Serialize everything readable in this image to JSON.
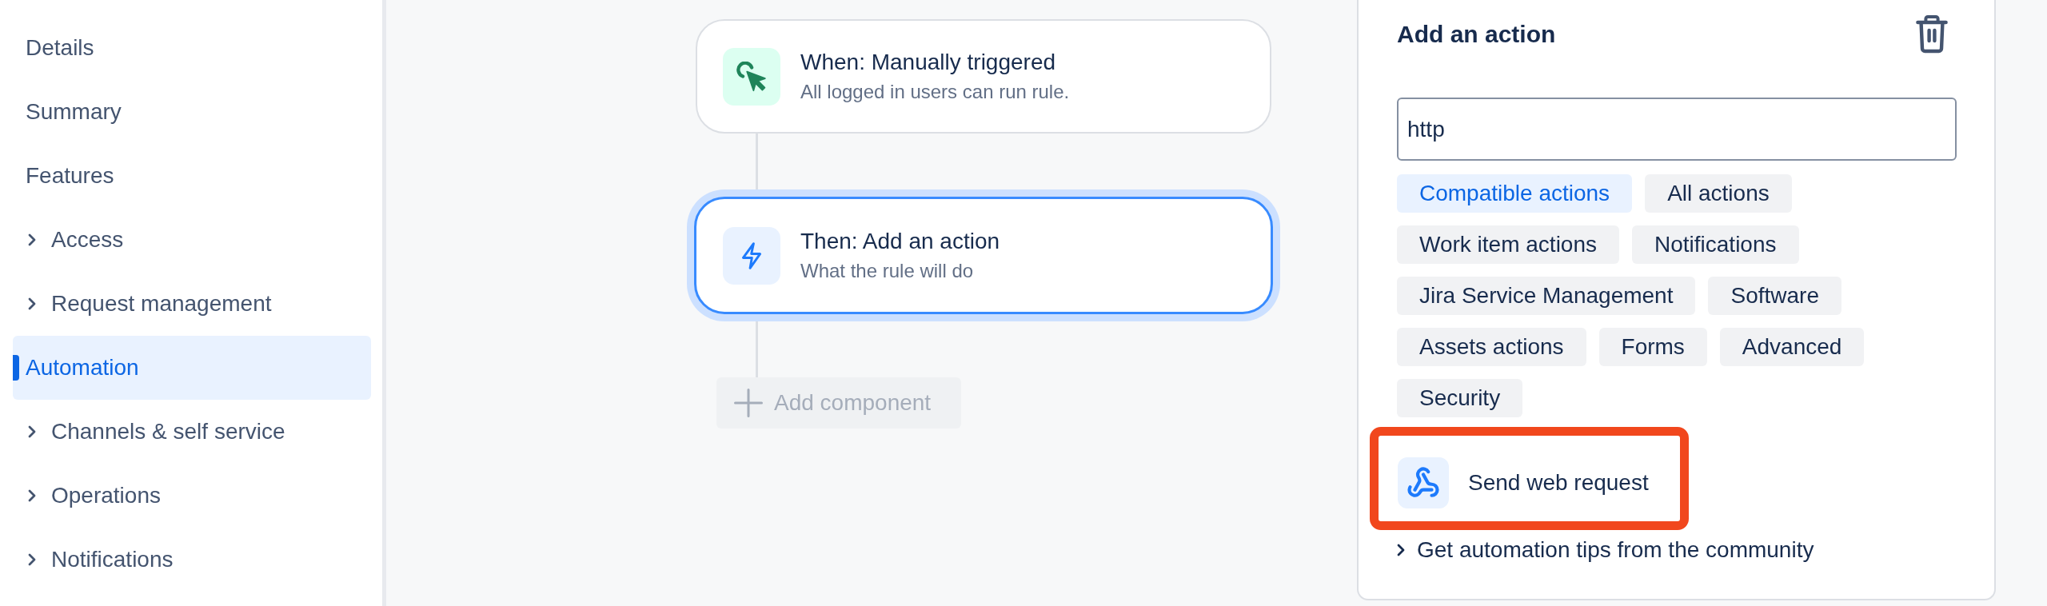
{
  "sidebar": {
    "items": [
      {
        "label": "Details",
        "expandable": false,
        "selected": false
      },
      {
        "label": "Summary",
        "expandable": false,
        "selected": false
      },
      {
        "label": "Features",
        "expandable": false,
        "selected": false
      },
      {
        "label": "Access",
        "expandable": true,
        "selected": false
      },
      {
        "label": "Request management",
        "expandable": true,
        "selected": false
      },
      {
        "label": "Automation",
        "expandable": false,
        "selected": true
      },
      {
        "label": "Channels & self service",
        "expandable": true,
        "selected": false
      },
      {
        "label": "Operations",
        "expandable": true,
        "selected": false
      },
      {
        "label": "Notifications",
        "expandable": true,
        "selected": false
      }
    ]
  },
  "rule_flow": {
    "steps": [
      {
        "kind": "trigger",
        "title": "When: Manually triggered",
        "subtitle": "All logged in users can run rule.",
        "selected": false
      },
      {
        "kind": "action",
        "title": "Then: Add an action",
        "subtitle": "What the rule will do",
        "selected": true
      }
    ],
    "add_component": {
      "label": "Add component",
      "disabled": true
    }
  },
  "action_panel": {
    "title": "Add an action",
    "search": {
      "value": "http"
    },
    "filters": [
      {
        "label": "Compatible actions",
        "selected": true
      },
      {
        "label": "All actions",
        "selected": false
      },
      {
        "label": "Work item actions",
        "selected": false
      },
      {
        "label": "Notifications",
        "selected": false
      },
      {
        "label": "Jira Service Management",
        "selected": false
      },
      {
        "label": "Software",
        "selected": false
      },
      {
        "label": "Assets actions",
        "selected": false
      },
      {
        "label": "Forms",
        "selected": false
      },
      {
        "label": "Advanced",
        "selected": false
      },
      {
        "label": "Security",
        "selected": false
      }
    ],
    "results": [
      {
        "label": "Send web request",
        "highlighted": true
      }
    ],
    "community_link": {
      "label": "Get automation tips from the community",
      "expanded": false
    }
  }
}
